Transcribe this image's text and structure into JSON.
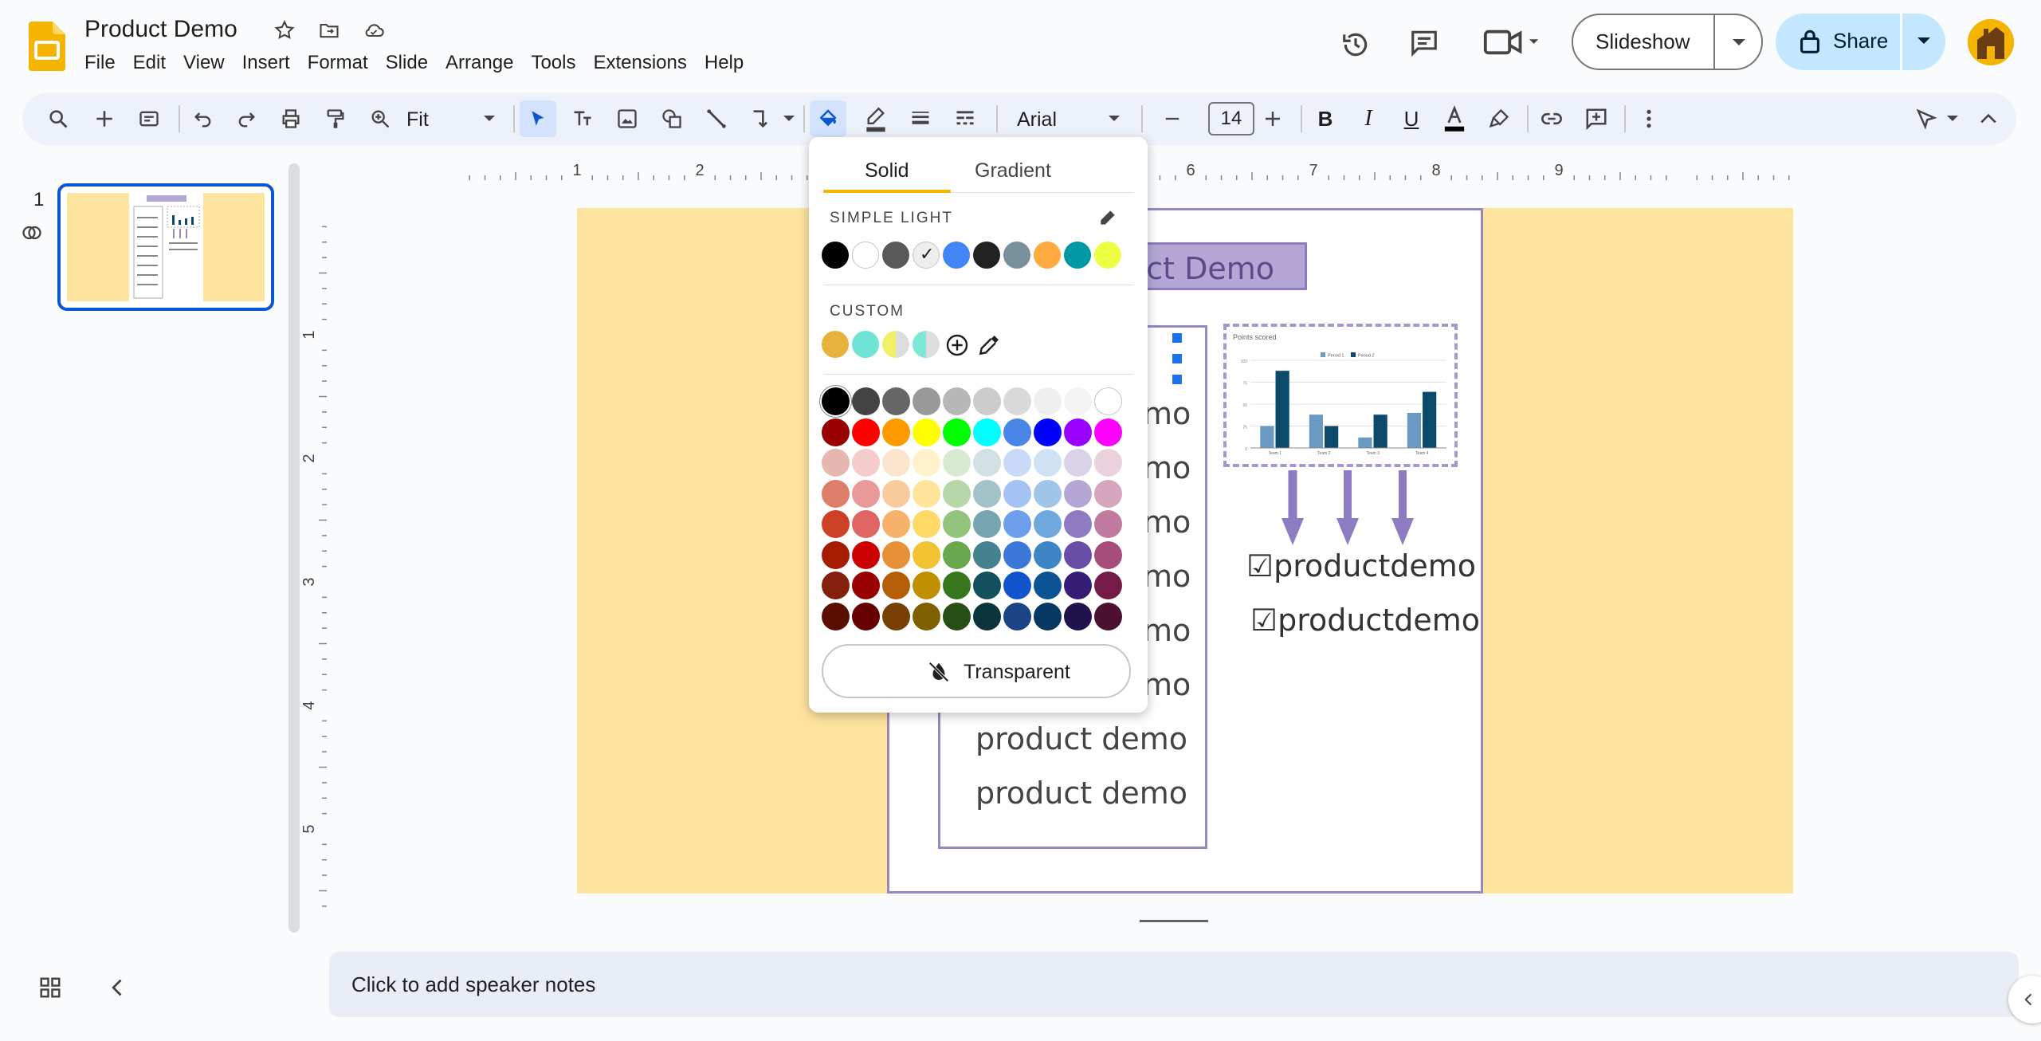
{
  "app": {
    "doc_title": "Product Demo",
    "menu": [
      "File",
      "Edit",
      "View",
      "Insert",
      "Format",
      "Slide",
      "Arrange",
      "Tools",
      "Extensions",
      "Help"
    ],
    "slideshow_label": "Slideshow",
    "share_label": "Share",
    "icons": [
      "slides-logo-icon",
      "star-icon",
      "move-to-folder-icon",
      "cloud-saved-icon",
      "history-icon",
      "comment-icon",
      "meet-icon",
      "lock-icon"
    ]
  },
  "toolbar": {
    "zoom": "Fit",
    "font": "Arial",
    "font_size": "14",
    "icons": [
      "search-icon",
      "add-icon",
      "new-slide-icon",
      "undo-icon",
      "redo-icon",
      "print-icon",
      "paint-format-icon",
      "zoom-icon",
      "select-icon",
      "text-box-icon",
      "image-icon",
      "shape-icon",
      "line-icon",
      "connector-icon",
      "fill-color-icon",
      "border-color-icon",
      "border-weight-icon",
      "border-dash-icon",
      "bold-icon",
      "italic-icon",
      "underline-icon",
      "text-color-icon",
      "highlight-icon",
      "link-icon",
      "insert-comment-icon",
      "more-icon",
      "pointer-mode-icon",
      "collapse-icon"
    ]
  },
  "filmstrip": {
    "slide_number": "1"
  },
  "slide": {
    "title": "Product Demo",
    "title_visible": "uct Demo",
    "lines_visible": [
      "mo",
      "mo",
      "mo",
      "mo",
      "mo",
      "mo",
      "product demo",
      "product demo"
    ],
    "check_items": [
      "☑productdemo",
      "☑productdemo"
    ],
    "chart_title": "Points scored",
    "legend": [
      "Period 1",
      "Period 2"
    ],
    "categories": [
      "Team 1",
      "Team 2",
      "Team 3",
      "Team 4"
    ]
  },
  "chart_data": {
    "type": "bar",
    "title": "Points scored",
    "categories": [
      "Team 1",
      "Team 2",
      "Team 3",
      "Team 4"
    ],
    "series": [
      {
        "name": "Period 1",
        "values": [
          25,
          38,
          12,
          40
        ],
        "color": "#6a9ac2"
      },
      {
        "name": "Period 2",
        "values": [
          88,
          25,
          38,
          64
        ],
        "color": "#0b4a6b"
      }
    ],
    "ylim": [
      0,
      100
    ],
    "yticks": [
      0,
      25,
      50,
      75,
      100
    ]
  },
  "ruler": {
    "h_labels": [
      "1",
      "2",
      "3",
      "4",
      "5",
      "6",
      "7",
      "8",
      "9"
    ],
    "v_labels": [
      "1",
      "2",
      "3",
      "4",
      "5"
    ]
  },
  "notes": {
    "placeholder": "Click to add speaker notes"
  },
  "color_picker": {
    "tab_solid": "Solid",
    "tab_gradient": "Gradient",
    "theme_label": "SIMPLE LIGHT",
    "custom_label": "CUSTOM",
    "transparent_label": "Transparent",
    "theme_colors": [
      "#000000",
      "#ffffff",
      "#595959",
      "#eeeeee",
      "#4285f4",
      "#212121",
      "#78909c",
      "#ffab40",
      "#0097a7",
      "#eeff41"
    ],
    "selected_theme_index": 3,
    "custom_colors": [
      "#e6b43c",
      "#6fe3d4",
      "#f0f06a",
      "#7ee8d8"
    ],
    "grid": [
      [
        "#000000",
        "#434343",
        "#666666",
        "#999999",
        "#b7b7b7",
        "#cccccc",
        "#d9d9d9",
        "#efefef",
        "#f3f3f3",
        "#ffffff"
      ],
      [
        "#980000",
        "#ff0000",
        "#ff9900",
        "#ffff00",
        "#00ff00",
        "#00ffff",
        "#4a86e8",
        "#0000ff",
        "#9900ff",
        "#ff00ff"
      ],
      [
        "#e6b8af",
        "#f4cccc",
        "#fce5cd",
        "#fff2cc",
        "#d9ead3",
        "#d0e0e3",
        "#c9daf8",
        "#cfe2f3",
        "#d9d2e9",
        "#ead1dc"
      ],
      [
        "#dd7e6b",
        "#ea9999",
        "#f9cb9c",
        "#ffe599",
        "#b6d7a8",
        "#a2c4c9",
        "#a4c2f4",
        "#9fc5e8",
        "#b4a7d6",
        "#d5a6bd"
      ],
      [
        "#cc4125",
        "#e06666",
        "#f6b26b",
        "#ffd966",
        "#93c47d",
        "#76a5af",
        "#6d9eeb",
        "#6fa8dc",
        "#8e7cc3",
        "#c27ba0"
      ],
      [
        "#a61c00",
        "#cc0000",
        "#e69138",
        "#f1c232",
        "#6aa84f",
        "#45818e",
        "#3c78d8",
        "#3d85c6",
        "#674ea7",
        "#a64d79"
      ],
      [
        "#85200c",
        "#990000",
        "#b45f06",
        "#bf9000",
        "#38761d",
        "#134f5c",
        "#1155cc",
        "#0b5394",
        "#351c75",
        "#741b47"
      ],
      [
        "#5b0f00",
        "#660000",
        "#783f04",
        "#7f6000",
        "#274e13",
        "#0c343d",
        "#1c4587",
        "#073763",
        "#20124d",
        "#4c1130"
      ]
    ]
  }
}
